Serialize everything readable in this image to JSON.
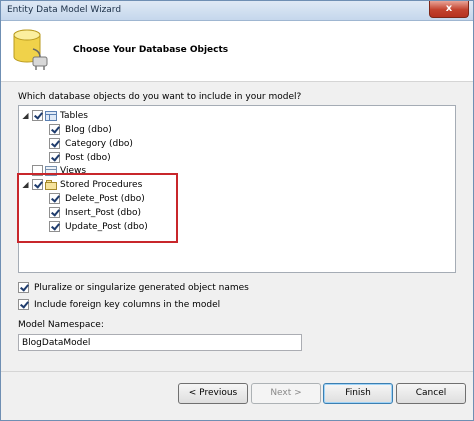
{
  "window": {
    "title": "Entity Data Model Wizard",
    "close_label": "x"
  },
  "header": {
    "title": "Choose Your Database Objects",
    "icon": "database-icon"
  },
  "question": "Which database objects do you want to include in your model?",
  "tree": {
    "tables": {
      "label": "Tables",
      "checked": true,
      "children": [
        {
          "label": "Blog (dbo)",
          "checked": true
        },
        {
          "label": "Category (dbo)",
          "checked": true
        },
        {
          "label": "Post (dbo)",
          "checked": true
        }
      ]
    },
    "views": {
      "label": "Views",
      "checked": false
    },
    "stored_procedures": {
      "label": "Stored Procedures",
      "checked": true,
      "children": [
        {
          "label": "Delete_Post (dbo)",
          "checked": true
        },
        {
          "label": "Insert_Post (dbo)",
          "checked": true
        },
        {
          "label": "Update_Post (dbo)",
          "checked": true
        }
      ]
    }
  },
  "options": {
    "pluralize": {
      "label": "Pluralize or singularize generated object names",
      "checked": true
    },
    "foreign_keys": {
      "label": "Include foreign key columns in the model",
      "checked": true
    }
  },
  "namespace": {
    "label": "Model Namespace:",
    "value": "BlogDataModel"
  },
  "buttons": {
    "previous": "< Previous",
    "next": "Next >",
    "finish": "Finish",
    "cancel": "Cancel"
  },
  "colors": {
    "highlight": "#c8262b",
    "title_gradient": "#c5d7ec"
  }
}
